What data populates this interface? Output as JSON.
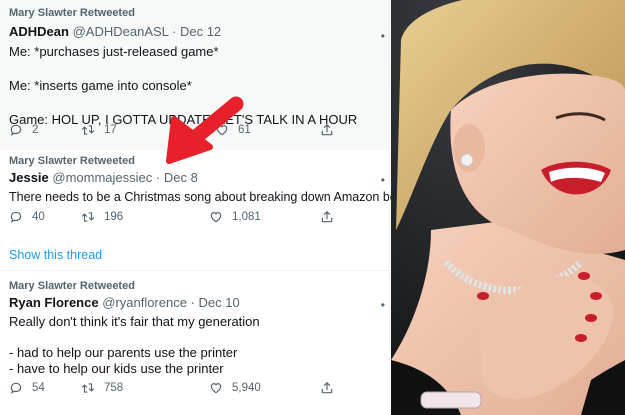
{
  "tweets": [
    {
      "retweeted_by": "Mary Slawter Retweeted",
      "display_name": "ADHDean",
      "handle": "@ADHDeanASL",
      "date": "· Dec 12",
      "lines": [
        "Me: *purchases just-released game*",
        "",
        "Me: *inserts game into console*",
        "",
        "Game: HOL UP, I GOTTA UPDATE, LET'S TALK IN A HOUR"
      ],
      "replies": "2",
      "retweets": "17",
      "likes": "61"
    },
    {
      "retweeted_by": "Mary Slawter Retweeted",
      "display_name": "Jessie",
      "handle": "@mommajessiec",
      "date": "· Dec 8",
      "lines": [
        "There needs to be a Christmas song about breaking down Amazon boxes."
      ],
      "replies": "40",
      "retweets": "196",
      "likes": "1,081"
    },
    {
      "retweeted_by": "Mary Slawter Retweeted",
      "display_name": "Ryan Florence",
      "handle": "@ryanflorence",
      "date": "· Dec 10",
      "lines": [
        "Really don't think it's fair that my generation",
        "",
        "- had to help our parents use the printer",
        "- have to help our kids use the printer"
      ],
      "replies": "54",
      "retweets": "758",
      "likes": "5,940"
    }
  ],
  "show_thread": "Show this thread",
  "icons": {
    "reply": "reply-icon",
    "retweet": "retweet-icon",
    "like": "like-icon",
    "share": "share-icon",
    "more": "more-icon"
  },
  "colors": {
    "accent": "#1d9bf0",
    "arrow": "#e8202a",
    "muted": "#536471"
  }
}
